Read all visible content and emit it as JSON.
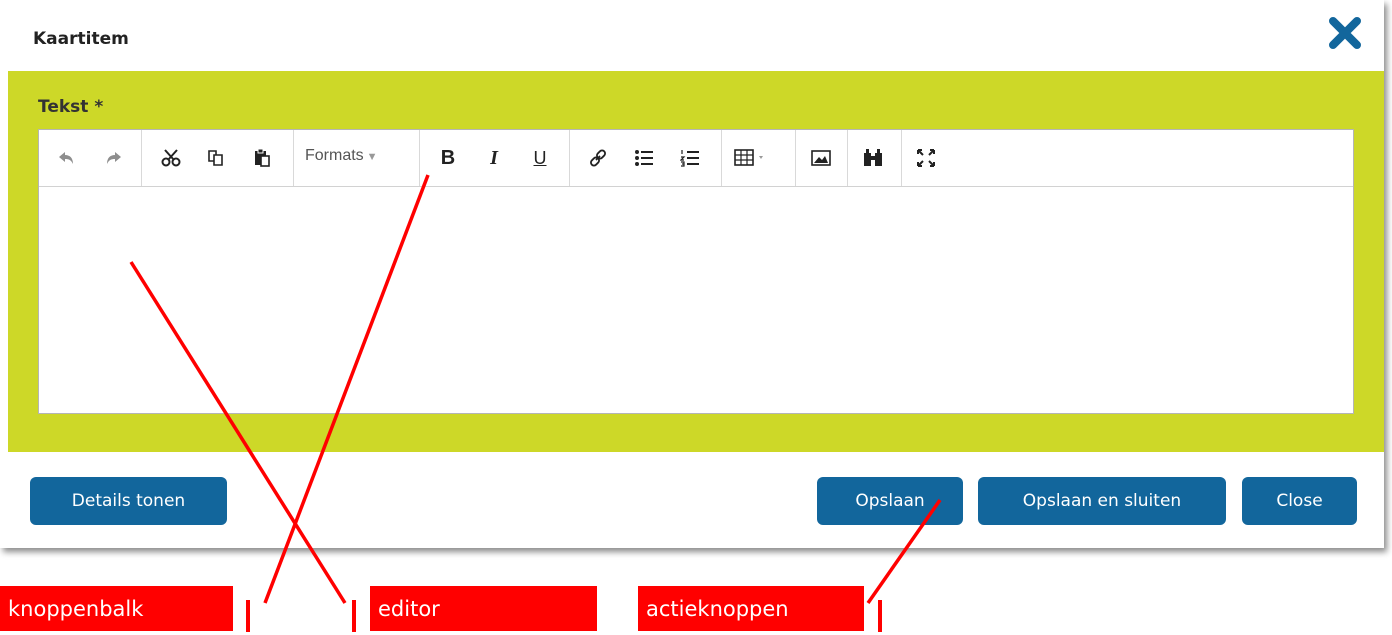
{
  "dialog": {
    "title": "Kaartitem",
    "close_icon": "close-x-icon"
  },
  "form": {
    "field_label": "Tekst *",
    "band_color": "#cdd828"
  },
  "toolbar": {
    "formats_label": "Formats",
    "bold_label": "B",
    "italic_label": "I",
    "underline_label": "U",
    "icons": [
      "undo-icon",
      "redo-icon",
      "cut-icon",
      "copy-icon",
      "paste-icon",
      "formats-dropdown",
      "bold-icon",
      "italic-icon",
      "underline-icon",
      "link-icon",
      "bullet-list-icon",
      "numbered-list-icon",
      "table-icon",
      "image-icon",
      "find-icon",
      "fullscreen-icon"
    ]
  },
  "footer": {
    "details_label": "Details tonen",
    "save_label": "Opslaan",
    "save_close_label": "Opslaan en sluiten",
    "close_label": "Close",
    "button_color": "#12669c"
  },
  "annotations": {
    "toolbar_label": "knoppenbalk",
    "editor_label": "editor",
    "actions_label": "actieknoppen",
    "color": "#ff0000"
  }
}
